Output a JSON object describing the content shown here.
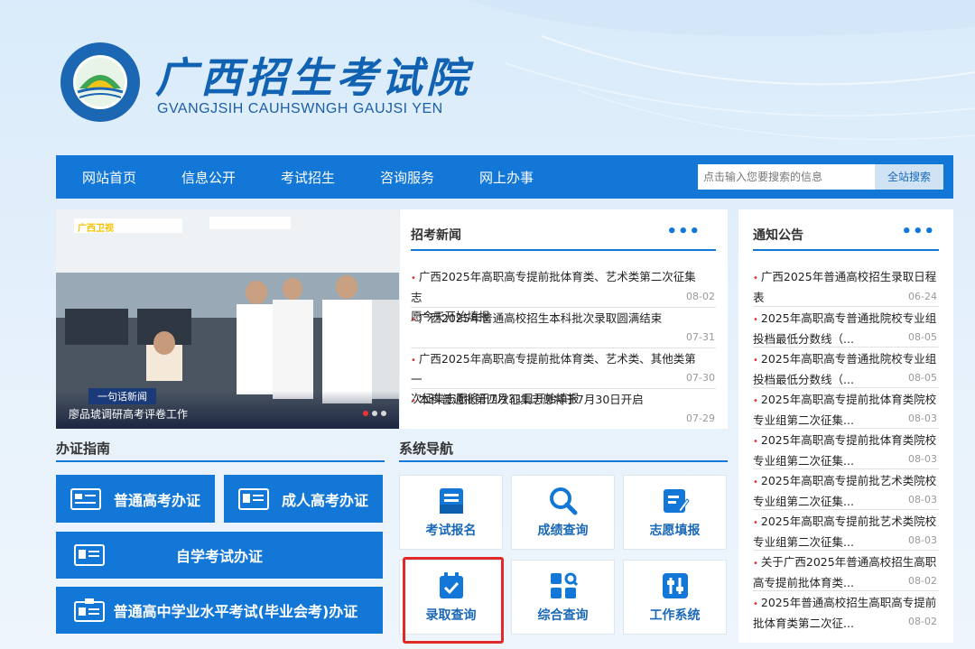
{
  "header": {
    "title": "广西招生考试院",
    "subtitle": "GVANGJSIH CAUHSWNGH GAUJSI YEN"
  },
  "nav": {
    "items": [
      "网站首页",
      "信息公开",
      "考试招生",
      "咨询服务",
      "网上办事"
    ],
    "search_placeholder": "点击输入您要搜索的信息",
    "search_button": "全站搜索"
  },
  "carousel": {
    "station": "广西卫视",
    "tag": "一句话新闻",
    "caption": "廖品琥调研高考评卷工作"
  },
  "news": {
    "title": "招考新闻",
    "more": "•••",
    "items": [
      {
        "line1": "广西2025年高职高专提前批体育类、艺术类第二次征集志",
        "line2": "愿今天开始填报",
        "date": "08-02"
      },
      {
        "line1": "广西2025年普通高校招生本科批次录取圆满结束",
        "line2": "",
        "date": "07-31"
      },
      {
        "line1": "广西2025年高职高专提前批体育类、艺术类、其他类第一",
        "line2": "次征集志愿将于7月31日开始填报",
        "date": "07-30"
      },
      {
        "line1": "本科普通批第四次征集志愿将于7月30日开启",
        "line2": "",
        "date": "07-29"
      }
    ]
  },
  "notices": {
    "title": "通知公告",
    "more": "•••",
    "items": [
      {
        "line1": "广西2025年普通高校招生录取日程",
        "line2": "表",
        "date": "06-24"
      },
      {
        "line1": "2025年高职高专普通批院校专业组",
        "line2": "投档最低分数线（...",
        "date": "08-05"
      },
      {
        "line1": "2025年高职高专普通批院校专业组",
        "line2": "投档最低分数线（...",
        "date": "08-05"
      },
      {
        "line1": "2025年高职高专提前批体育类院校",
        "line2": "专业组第二次征集...",
        "date": "08-03"
      },
      {
        "line1": "2025年高职高专提前批体育类院校",
        "line2": "专业组第二次征集...",
        "date": "08-03"
      },
      {
        "line1": "2025年高职高专提前批艺术类院校",
        "line2": "专业组第二次征集...",
        "date": "08-03"
      },
      {
        "line1": "2025年高职高专提前批艺术类院校",
        "line2": "专业组第二次征集...",
        "date": "08-03"
      },
      {
        "line1": "关于广西2025年普通高校招生高职",
        "line2": "高专提前批体育类...",
        "date": "08-02"
      },
      {
        "line1": "2025年普通高校招生高职高专提前",
        "line2": "批体育类第二次征...",
        "date": "08-02"
      }
    ]
  },
  "guide": {
    "title": "办证指南",
    "buttons": [
      "普通高考办证",
      "成人高考办证",
      "自学考试办证",
      "普通高中学业水平考试(毕业会考)办证"
    ]
  },
  "system": {
    "title": "系统导航",
    "tiles": [
      "考试报名",
      "成绩查询",
      "志愿填报",
      "录取查询",
      "综合查询",
      "工作系统"
    ]
  },
  "colors": {
    "primary": "#1277d6",
    "highlight": "#e02a2a",
    "bullet": "#dd3333"
  }
}
